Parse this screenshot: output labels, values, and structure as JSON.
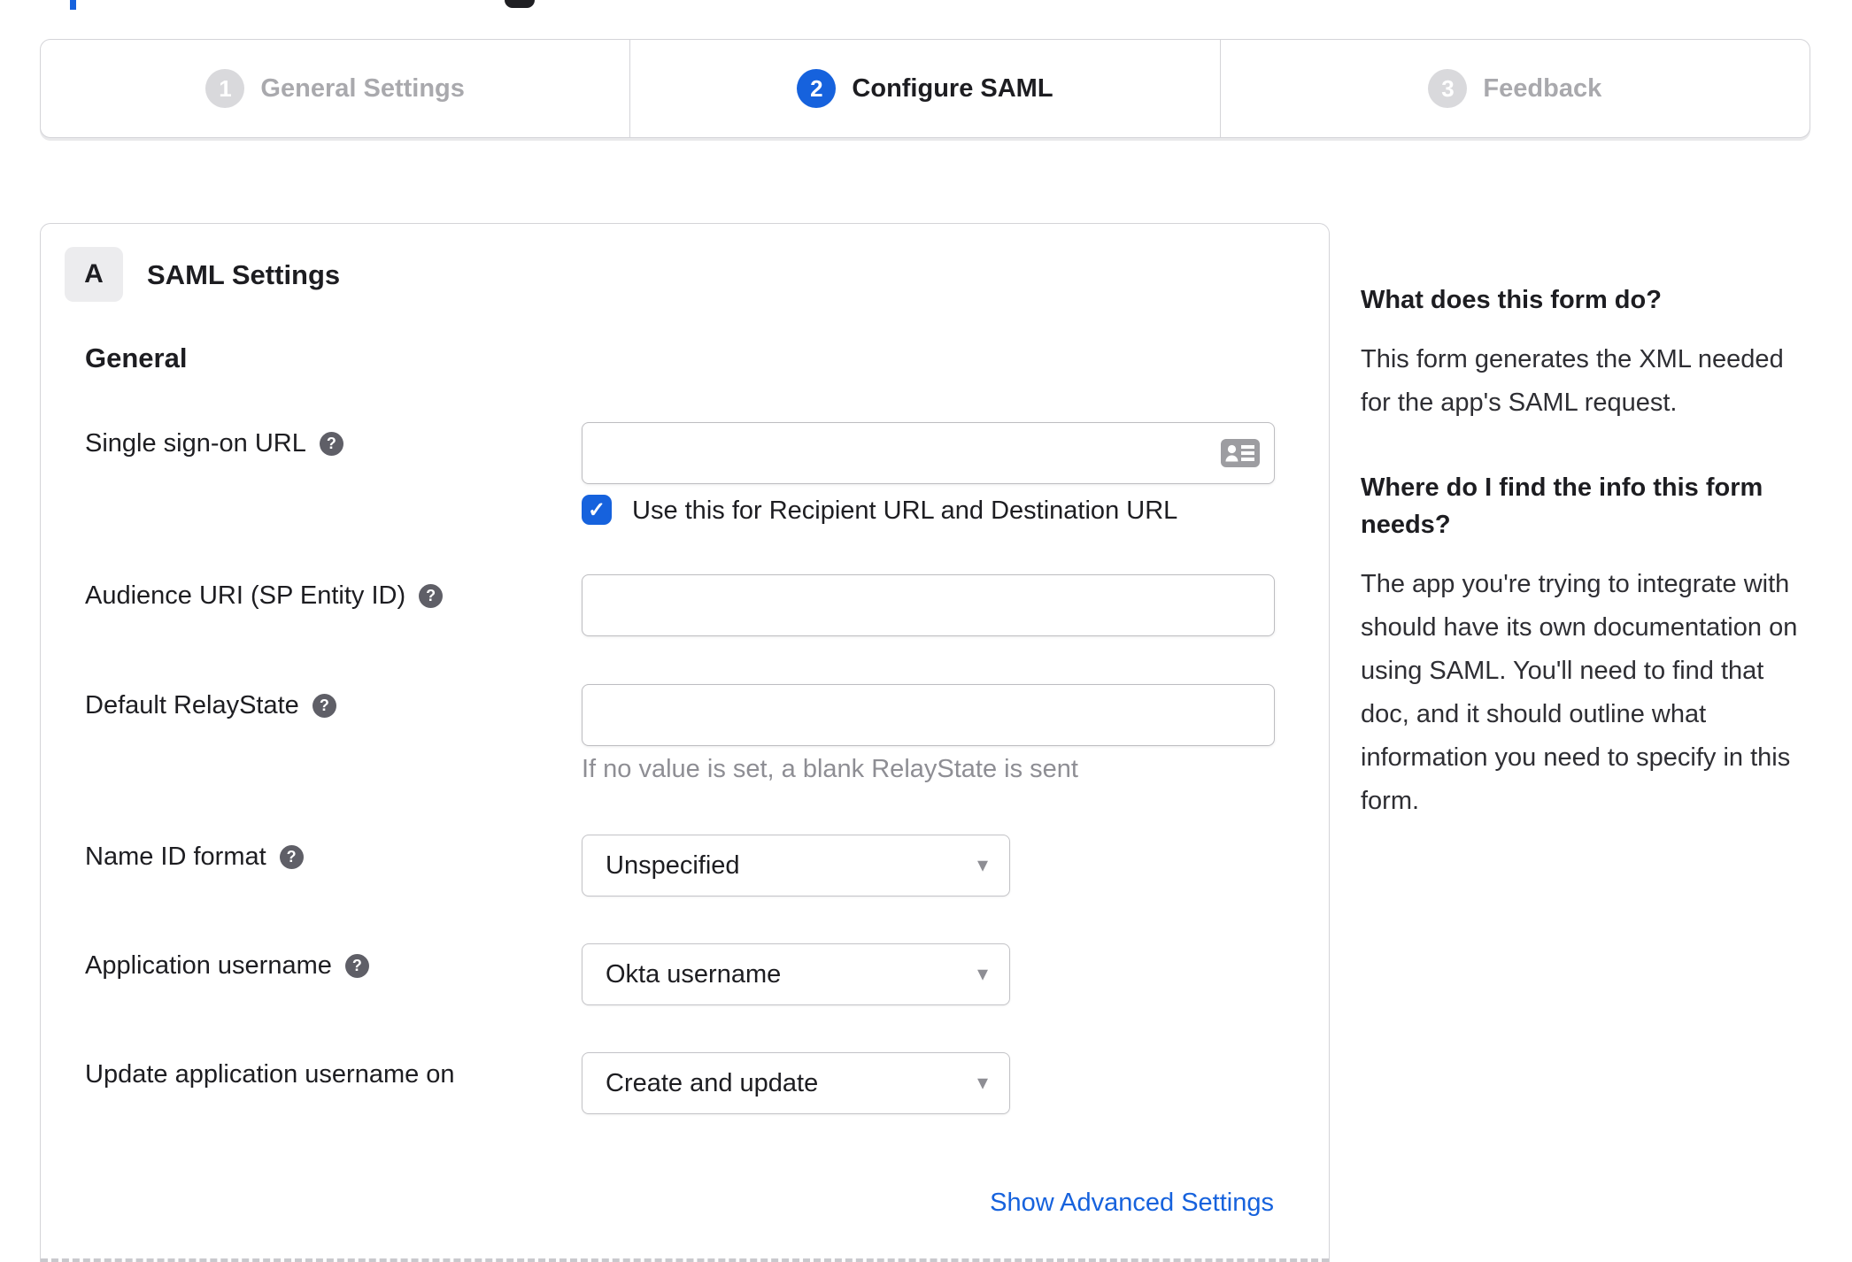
{
  "colors": {
    "accent_blue": "#1662dd",
    "text_dark": "#1d1d21",
    "inactive_gray": "#a9a9ad",
    "hint_gray": "#8e8e94",
    "border_gray": "#d4d4d8",
    "help_icon_bg": "#5f5f67"
  },
  "icons": {
    "help_glyph": "?",
    "caret_glyph": "▾",
    "check_glyph": "✓"
  },
  "stepper": {
    "steps": [
      {
        "number": "1",
        "label": "General Settings",
        "state": "inactive"
      },
      {
        "number": "2",
        "label": "Configure SAML",
        "state": "active"
      },
      {
        "number": "3",
        "label": "Feedback",
        "state": "inactive"
      }
    ]
  },
  "form": {
    "section_badge": "A",
    "section_title": "SAML Settings",
    "group_heading": "General",
    "sso": {
      "label": "Single sign-on URL",
      "value": "",
      "checkbox_label": "Use this for Recipient URL and Destination URL",
      "checkbox_checked": true
    },
    "audience": {
      "label": "Audience URI (SP Entity ID)",
      "value": ""
    },
    "relay_state": {
      "label": "Default RelayState",
      "value": "",
      "hint": "If no value is set, a blank RelayState is sent"
    },
    "name_id_format": {
      "label": "Name ID format",
      "value": "Unspecified"
    },
    "application_username": {
      "label": "Application username",
      "value": "Okta username"
    },
    "update_username": {
      "label": "Update application username on",
      "value": "Create and update"
    },
    "advanced_link": "Show Advanced Settings"
  },
  "sidebar": {
    "sections": [
      {
        "heading": "What does this form do?",
        "body": "This form generates the XML needed for the app's SAML request."
      },
      {
        "heading": "Where do I find the info this form needs?",
        "body": "The app you're trying to integrate with should have its own documentation on using SAML. You'll need to find that doc, and it should outline what information you need to specify in this form."
      }
    ]
  }
}
